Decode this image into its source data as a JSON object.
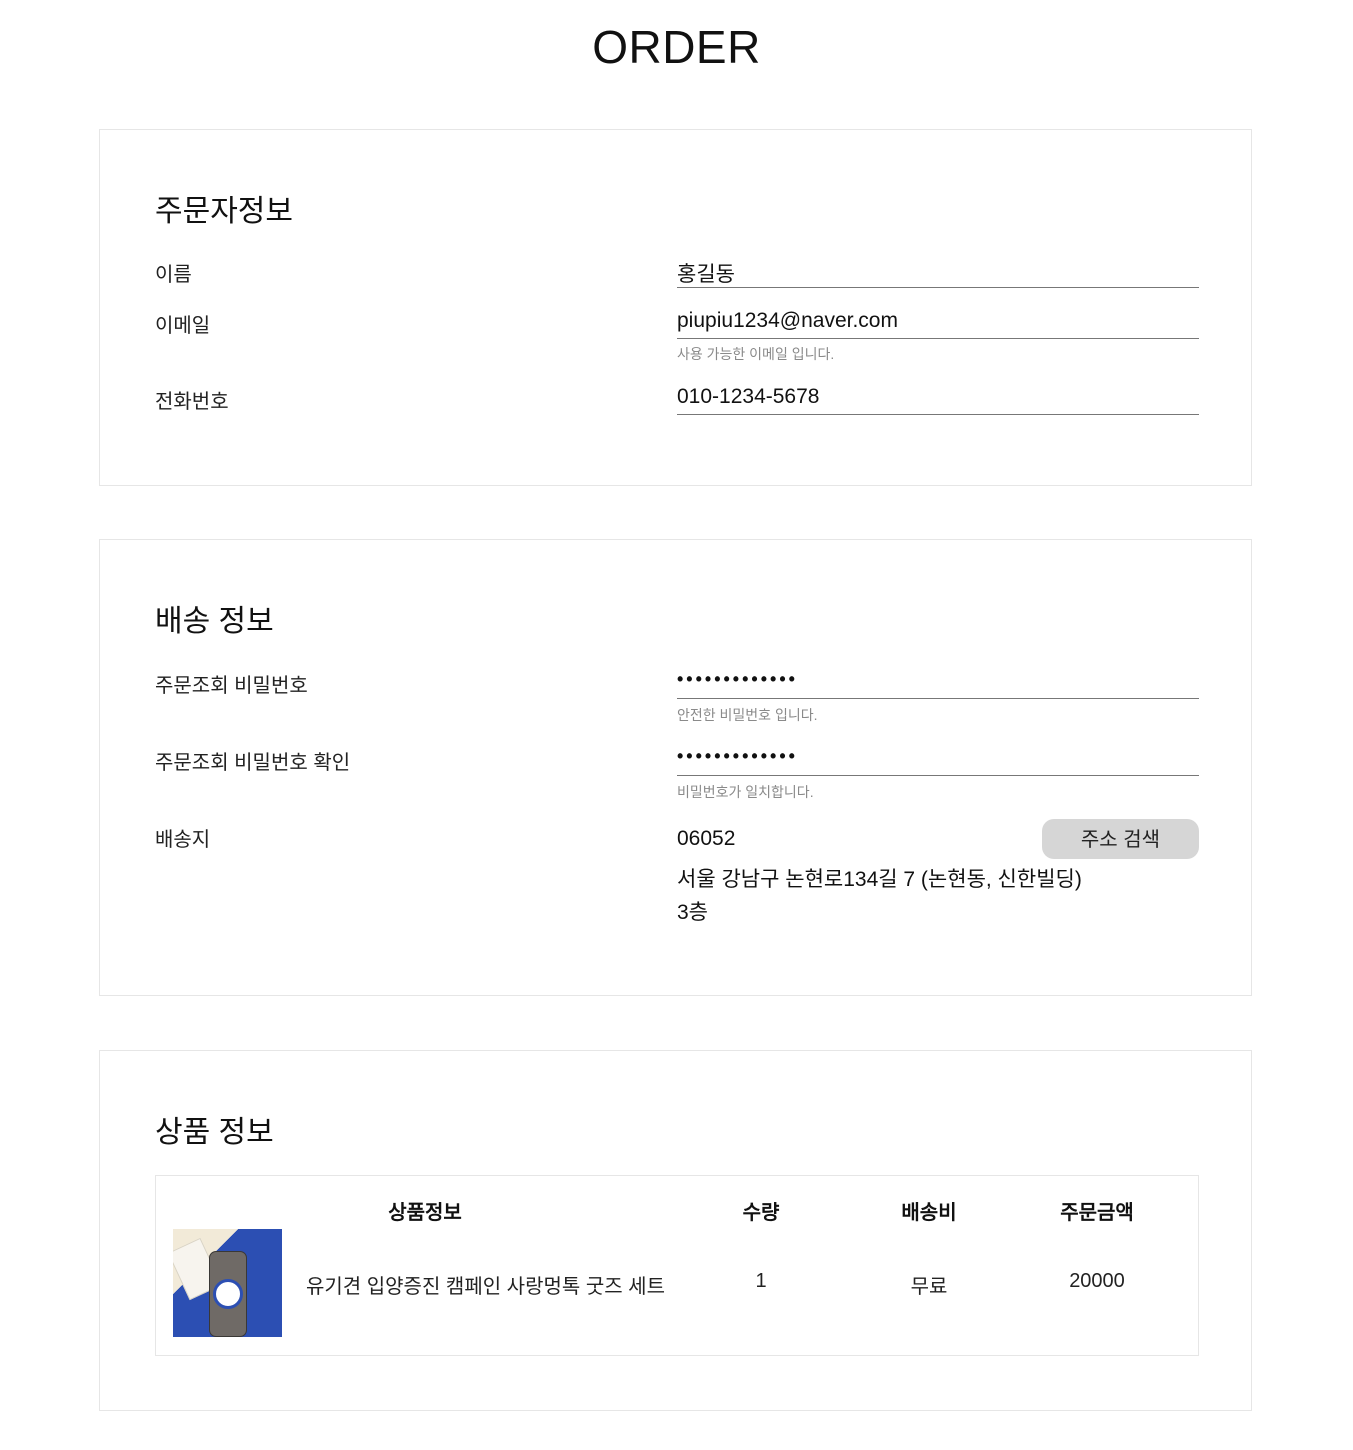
{
  "page": {
    "title": "ORDER"
  },
  "orderer": {
    "section_title": "주문자정보",
    "name_label": "이름",
    "name_value": "홍길동",
    "email_label": "이메일",
    "email_value": "piupiu1234@naver.com",
    "email_hint": "사용 가능한 이메일 입니다.",
    "phone_label": "전화번호",
    "phone_value": "010-1234-5678"
  },
  "shipping": {
    "section_title": "배송 정보",
    "password_label": "주문조회 비밀번호",
    "password_value": "•••••••••••••",
    "password_hint": "안전한 비밀번호 입니다.",
    "password_confirm_label": "주문조회 비밀번호 확인",
    "password_confirm_value": "•••••••••••••",
    "password_confirm_hint": "비밀번호가 일치합니다.",
    "address_label": "배송지",
    "postcode": "06052",
    "address_search_button": "주소 검색",
    "address_line1": "서울 강남구 논현로134길 7 (논현동, 신한빌딩)",
    "address_line2": "3층"
  },
  "product": {
    "section_title": "상품 정보",
    "headers": {
      "info": "상품정보",
      "quantity": "수량",
      "shipping_fee": "배송비",
      "amount": "주문금액"
    },
    "item": {
      "name": "유기견 입양증진 캠페인 사랑멍톡 굿즈 세트",
      "quantity": "1",
      "shipping_fee": "무료",
      "amount": "20000",
      "thumbnail_icon": "product-photo"
    }
  }
}
